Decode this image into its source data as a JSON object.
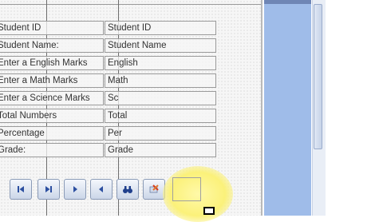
{
  "form": {
    "rows": [
      {
        "label": "Student ID",
        "field": "Student  ID"
      },
      {
        "label": "Student Name:",
        "field": "Student  Name"
      },
      {
        "label": "Enter a English Marks",
        "field": "English"
      },
      {
        "label": "Enter a Math Marks",
        "field": "Math"
      },
      {
        "label": "Enter a Science Marks",
        "field": "Sc"
      },
      {
        "label": "Total Numbers",
        "field": "Total"
      },
      {
        "label": "Percentage",
        "field": "Per"
      },
      {
        "label": "Grade:",
        "field": "Grade"
      }
    ]
  },
  "navigation": {
    "buttons": [
      {
        "name": "first-record-icon"
      },
      {
        "name": "last-record-icon"
      },
      {
        "name": "next-record-icon"
      },
      {
        "name": "previous-record-icon"
      },
      {
        "name": "find-record-icon"
      },
      {
        "name": "delete-record-icon"
      }
    ]
  },
  "colors": {
    "canvas": "#f6f6f6",
    "panel": "#9fbce9",
    "highlight": "#fbf17a",
    "button": "#cbd6e8"
  }
}
